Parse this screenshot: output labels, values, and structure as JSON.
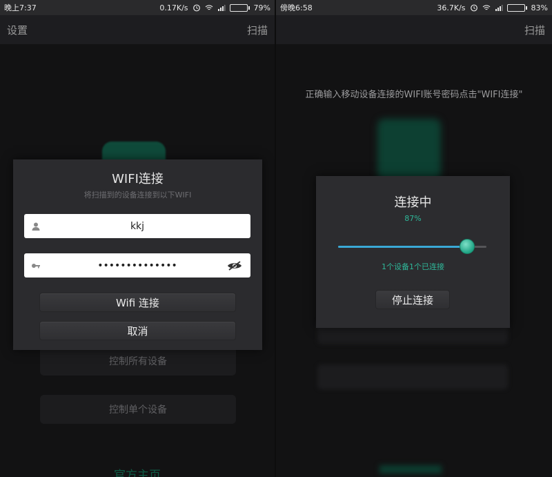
{
  "left": {
    "status": {
      "time": "晚上7:37",
      "speed": "0.17K/s",
      "battery": "79%",
      "battery_level": 0.79
    },
    "appbar": {
      "left_label": "设置",
      "right_label": "扫描"
    },
    "background": {
      "btn1": "控制所有设备",
      "btn2": "控制单个设备",
      "link": "官方主页"
    },
    "dialog": {
      "title": "WIFI连接",
      "subtitle": "将扫描到的设备连接到以下WIFI",
      "ssid_value": "kkj",
      "password_value": "••••••••••••••",
      "connect_label": "Wifi 连接",
      "cancel_label": "取消"
    }
  },
  "right": {
    "status": {
      "time": "傍晚6:58",
      "speed": "36.7K/s",
      "battery": "83%",
      "battery_level": 0.83
    },
    "appbar": {
      "right_label": "扫描"
    },
    "hint": "正确输入移动设备连接的WIFI账号密码点击\"WIFI连接\"",
    "dialog": {
      "title": "连接中",
      "percent": "87%",
      "progress": 0.87,
      "status": "1个设备1个已连接",
      "stop_label": "停止连接"
    }
  },
  "colors": {
    "accent": "#2fb89a",
    "battery": "#f0a020",
    "slider": "#3aa9d6"
  }
}
